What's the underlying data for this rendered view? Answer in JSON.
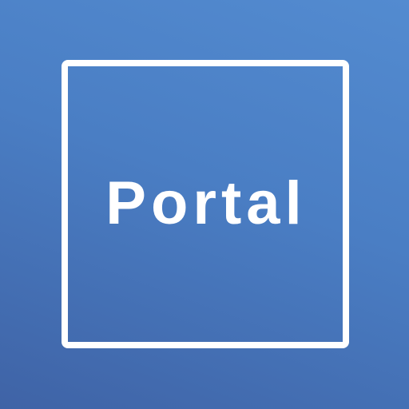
{
  "logo": {
    "wordmark": "Portal"
  }
}
